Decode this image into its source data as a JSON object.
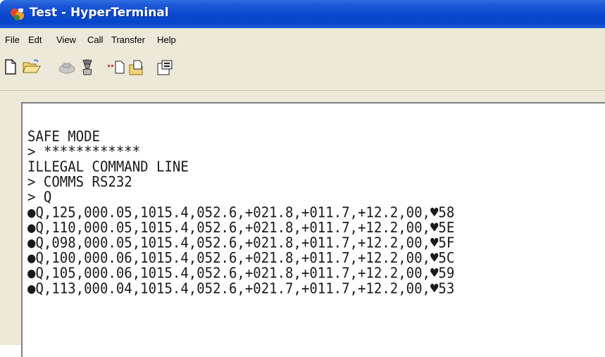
{
  "window": {
    "title": "Test - HyperTerminal"
  },
  "menu": {
    "file": "File",
    "edit": "Edt",
    "view": "View",
    "call": "Call",
    "transfer": "Transfer",
    "help": "Help"
  },
  "toolbar": {
    "icons": [
      "new-file-icon",
      "open-folder-icon",
      "connect-phone-icon",
      "disconnect-phone-icon",
      "send-icon",
      "receive-icon",
      "properties-icon"
    ]
  },
  "terminal": {
    "lines": [
      "SAFE MODE",
      "> ************",
      "ILLEGAL COMMAND LINE",
      "> COMMS RS232",
      "> Q",
      "●Q,125,000.05,1015.4,052.6,+021.8,+011.7,+12.2,00,♥58",
      "●Q,110,000.05,1015.4,052.6,+021.8,+011.7,+12.2,00,♥5E",
      "●Q,098,000.05,1015.4,052.6,+021.8,+011.7,+12.2,00,♥5F",
      "●Q,100,000.06,1015.4,052.6,+021.8,+011.7,+12.2,00,♥5C",
      "●Q,105,000.06,1015.4,052.6,+021.8,+011.7,+12.2,00,♥59",
      "●Q,113,000.04,1015.4,052.6,+021.7,+011.7,+12.2,00,♥53"
    ]
  }
}
